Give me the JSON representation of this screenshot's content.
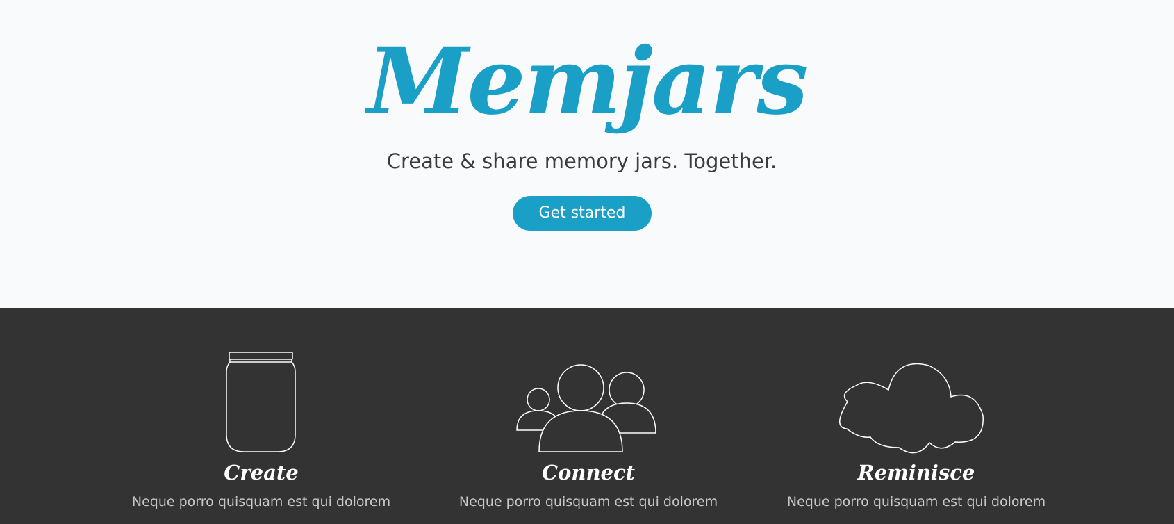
{
  "hero": {
    "logo": "Memjars",
    "tagline": "Create & share memory jars. Together.",
    "cta_label": "Get started"
  },
  "features": [
    {
      "icon": "jar-icon",
      "title": "Create",
      "description": "Neque porro quisquam est qui dolorem"
    },
    {
      "icon": "people-group-icon",
      "title": "Connect",
      "description": "Neque porro quisquam est qui dolorem"
    },
    {
      "icon": "cloud-icon",
      "title": "Reminisce",
      "description": "Neque porro quisquam est qui dolorem"
    }
  ],
  "colors": {
    "brand": "#1a9fc6",
    "hero_background": "#f9fafc",
    "features_background": "#333333",
    "tagline_text": "#3c3c3c",
    "feature_description_text": "#c8c8c8"
  }
}
